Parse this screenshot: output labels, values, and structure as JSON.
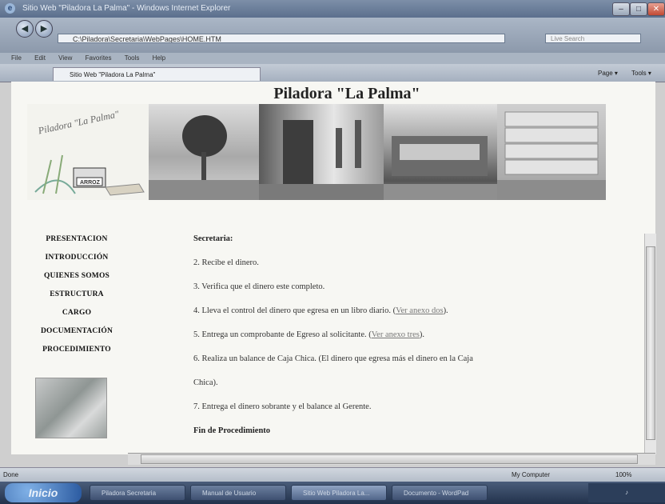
{
  "window": {
    "title": "Sitio Web \"Piladora La Palma\" - Windows Internet Explorer",
    "address": "C:\\Piladora\\Secretaria\\WebPages\\HOME.HTM",
    "search_placeholder": "Live Search",
    "menu": [
      "File",
      "Edit",
      "View",
      "Favorites",
      "Tools",
      "Help"
    ],
    "tab_label": "Sitio Web \"Piladora La Palma\"",
    "toolbar": [
      "Page ▾",
      "Tools ▾"
    ],
    "buttons": {
      "minimize": "–",
      "maximize": "□",
      "close": "✕",
      "back": "◀",
      "forward": "▶"
    }
  },
  "page": {
    "title": "Piladora \"La Palma\"",
    "logo_text": "Piladora \"La Palma\"",
    "logo_box": "ARROZ",
    "nav": [
      "PRESENTACION",
      "INTRODUCCIÓN",
      "QUIENES SOMOS",
      "ESTRUCTURA",
      "CARGO",
      "DOCUMENTACIÓN",
      "PROCEDIMIENTO"
    ],
    "section_heading": "Secretaria:",
    "steps": [
      {
        "text": "2. Recibe el dinero."
      },
      {
        "text": "3. Verifica que el dinero este completo."
      },
      {
        "text": "4. Lleva el control del dinero que egresa en un libro diario. (",
        "link": "Ver anexo dos",
        "after": ")."
      },
      {
        "text": "5. Entrega un comprobante de Egreso al solicitante. (",
        "link": "Ver anexo tres",
        "after": ")."
      },
      {
        "text": "6. Realiza un balance de Caja Chica. (El dinero que egresa más el dinero en la Caja"
      },
      {
        "text": "Chica)."
      },
      {
        "text": "7. Entrega el dinero sobrante y el balance al Gerente."
      }
    ],
    "footer_heading": "Fin de Procedimiento"
  },
  "status": {
    "left": "Done",
    "zone": "My Computer",
    "zoom": "100%"
  },
  "taskbar": {
    "start": "Inicio",
    "items": [
      "Piladora Secretaria",
      "Manual de Usuario",
      "Sitio Web Piladora La...",
      "Documento - WordPad"
    ]
  }
}
